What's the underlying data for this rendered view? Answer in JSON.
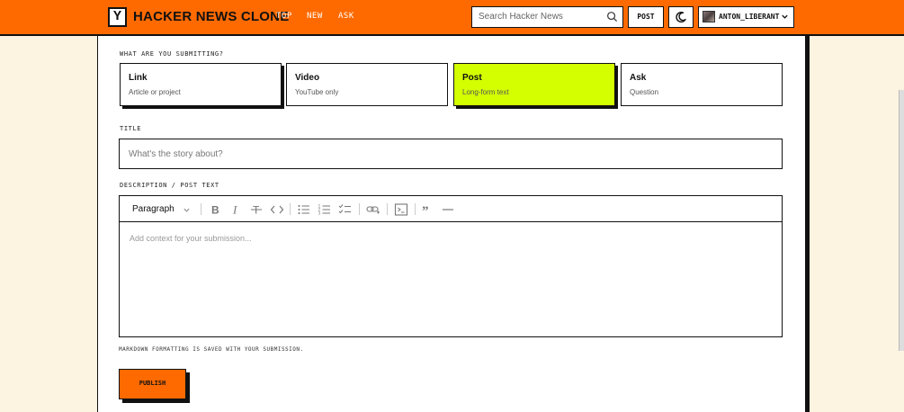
{
  "header": {
    "logo_letter": "Y",
    "brand": "HACKER NEWS CLONE",
    "nav": [
      "TOP",
      "NEW",
      "ASK"
    ],
    "search_placeholder": "Search Hacker News",
    "post_label": "POST",
    "theme_icon": "moon-icon",
    "username": "ANTON_LIBERANT"
  },
  "form": {
    "type_label": "WHAT ARE YOU SUBMITTING?",
    "types": [
      {
        "title": "Link",
        "subtitle": "Article or project",
        "selected": false
      },
      {
        "title": "Video",
        "subtitle": "YouTube only",
        "selected": false
      },
      {
        "title": "Post",
        "subtitle": "Long-form text",
        "selected": true
      },
      {
        "title": "Ask",
        "subtitle": "Question",
        "selected": false
      }
    ],
    "title_label": "TITLE",
    "title_placeholder": "What's the story about?",
    "description_label": "DESCRIPTION / POST TEXT",
    "editor": {
      "block_type": "Paragraph",
      "toolbar_icons": [
        "bold-icon",
        "italic-icon",
        "strikethrough-icon",
        "code-icon",
        "bullet-list-icon",
        "numbered-list-icon",
        "checklist-icon",
        "link-icon",
        "code-block-icon",
        "quote-icon",
        "horizontal-rule-icon"
      ],
      "placeholder": "Add context for your submission..."
    },
    "helper_text": "MARKDOWN FORMATTING IS SAVED WITH YOUR SUBMISSION.",
    "publish_label": "PUBLISH"
  },
  "colors": {
    "accent": "#ff6a00",
    "selected": "#d4ff00",
    "page_bg": "#fdf3e1",
    "ink": "#111111"
  }
}
